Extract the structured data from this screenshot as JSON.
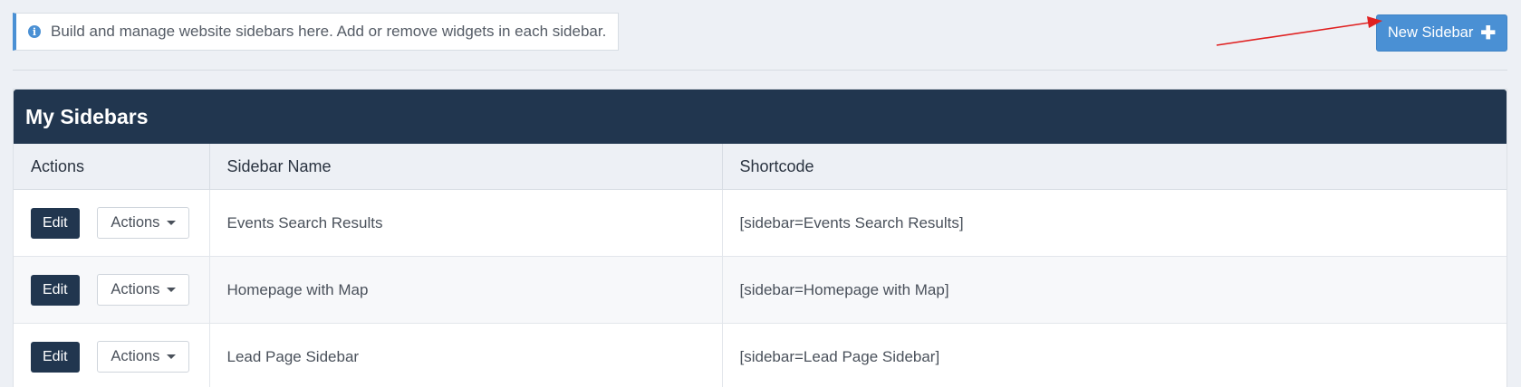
{
  "notice": {
    "icon": "info-icon",
    "text": "Build and manage website sidebars here. Add or remove widgets in each sidebar."
  },
  "toolbar": {
    "new_sidebar_label": "New Sidebar",
    "new_sidebar_icon": "plus-icon"
  },
  "panel": {
    "title": "My Sidebars"
  },
  "table": {
    "columns": [
      "Actions",
      "Sidebar Name",
      "Shortcode"
    ],
    "rows": [
      {
        "edit": "Edit",
        "actions": "Actions",
        "name": "Events Search Results",
        "shortcode": "[sidebar=Events Search Results]"
      },
      {
        "edit": "Edit",
        "actions": "Actions",
        "name": "Homepage with Map",
        "shortcode": "[sidebar=Homepage with Map]"
      },
      {
        "edit": "Edit",
        "actions": "Actions",
        "name": "Lead Page Sidebar",
        "shortcode": "[sidebar=Lead Page Sidebar]"
      }
    ]
  },
  "colors": {
    "accent": "#4a90d4",
    "header": "#21364f",
    "annotation_arrow": "#e02020"
  }
}
